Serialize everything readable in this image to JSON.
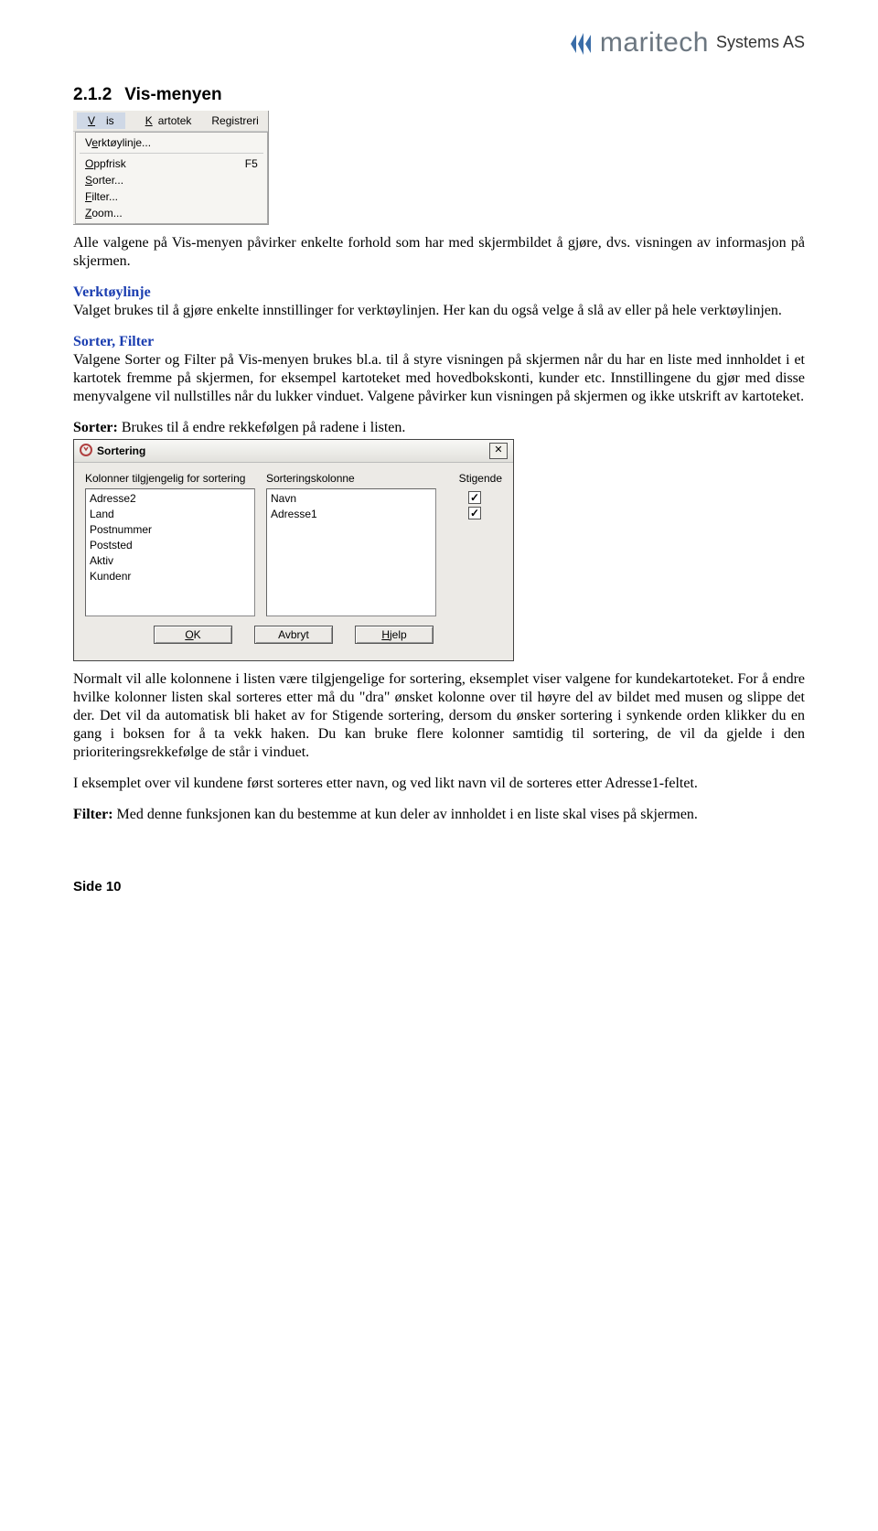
{
  "logo": {
    "brand": "maritech",
    "suffix": "Systems AS"
  },
  "section": {
    "number": "2.1.2",
    "title": "Vis-menyen"
  },
  "menu_shot": {
    "bar": [
      "Vis",
      "Kartotek",
      "Registreri"
    ],
    "items": [
      {
        "label": "Verktøylinje...",
        "shortcut": ""
      },
      {
        "sep": true
      },
      {
        "label": "Oppfrisk",
        "shortcut": "F5"
      },
      {
        "label": "Sorter...",
        "shortcut": ""
      },
      {
        "label": "Filter...",
        "shortcut": ""
      },
      {
        "label": "Zoom...",
        "shortcut": ""
      }
    ]
  },
  "para1": "Alle valgene på Vis-menyen påvirker enkelte forhold som har med skjermbildet å gjøre, dvs. visningen av informasjon på skjermen.",
  "sub_verktoy": "Verktøylinje",
  "para2": "Valget brukes til å gjøre enkelte innstillinger for verktøylinjen. Her kan du også velge å slå av eller på hele verktøylinjen.",
  "sub_sorter_filter": "Sorter, Filter",
  "para3": "Valgene Sorter og Filter på Vis-menyen brukes bl.a. til å styre visningen på skjermen når du har en liste med innholdet i et kartotek fremme på skjermen, for eksempel kartoteket med hovedbokskonti, kunder etc. Innstillingene du gjør med disse menyvalgene vil nullstilles når du lukker vinduet. Valgene påvirker kun visningen på skjermen og ikke utskrift av kartoteket.",
  "sorter_label": "Sorter:",
  "para4": " Brukes til å endre rekkefølgen på radene i listen.",
  "dialog": {
    "title": "Sortering",
    "col_left_label": "Kolonner tilgjengelig for sortering",
    "col_mid_label": "Sorteringskolonne",
    "col_right_label": "Stigende",
    "left_items": [
      "Adresse2",
      "Land",
      "Postnummer",
      "Poststed",
      "Aktiv",
      "Kundenr"
    ],
    "mid_items": [
      "Navn",
      "Adresse1"
    ],
    "checks": [
      true,
      true
    ],
    "buttons": {
      "ok": "OK",
      "cancel": "Avbryt",
      "help": "Hjelp"
    }
  },
  "para5": "Normalt vil alle kolonnene i listen være tilgjengelige for sortering, eksemplet viser valgene for kundekartoteket. For å endre hvilke kolonner listen skal sorteres etter må du \"dra\" ønsket kolonne over til høyre del av bildet med musen og slippe det der. Det vil da automatisk bli haket av for Stigende sortering, dersom du ønsker sortering i synkende orden klikker du en gang i boksen for å ta vekk haken. Du kan bruke flere kolonner samtidig til sortering, de vil da gjelde i den prioriteringsrekkefølge de står i vinduet.",
  "para6": "I eksemplet over vil kundene først sorteres etter navn, og ved likt navn vil de sorteres etter Adresse1-feltet.",
  "filter_label": "Filter:",
  "para7": " Med denne funksjonen kan du bestemme at kun deler av innholdet i en liste skal vises på skjermen.",
  "footer": "Side 10"
}
